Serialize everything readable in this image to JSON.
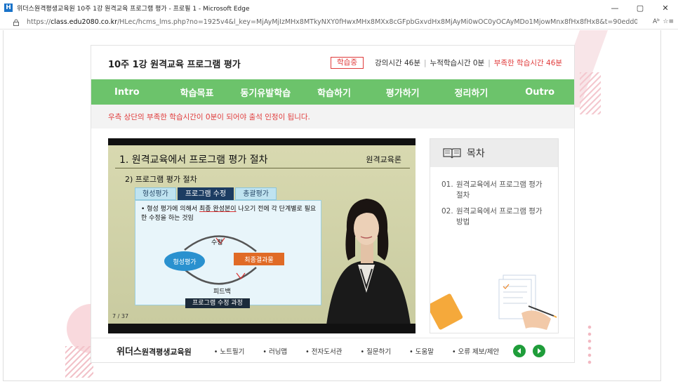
{
  "window": {
    "app_icon": "H",
    "title": "위더스원격평생교육원 10주 1강 원격교육 프로그램 평가 - 프로필 1 - Microsoft Edge",
    "min_icon": "—",
    "max_icon": "▢",
    "close_icon": "✕"
  },
  "address": {
    "url_prefix": "https://",
    "url_host": "class.edu2080.co.kr",
    "url_rest": "/HLec/hcms_lms.php?no=1925v4&l_key=MjAyMjIzMHx8MTkyNXY0fHwxMHx8MXx8cGFpbGxvdHx8MjAyMi0wOC0yOCAyMDo1MjowMnx8fHx8fHx8&t=90edd038f48d4ff53ca205...",
    "read_aloud": "Aᵇ",
    "extra": "☆≡"
  },
  "header": {
    "title": "10주 1강 원격교육 프로그램 평가",
    "status_badge": "학습중",
    "lecture_time": "강의시간 46분",
    "accumulated_time": "누적학습시간 0분",
    "remaining_time": "부족한 학습시간 46분"
  },
  "nav": {
    "items": [
      "Intro",
      "학습목표",
      "동기유발학습",
      "학습하기",
      "평가하기",
      "정리하기",
      "Outro"
    ]
  },
  "notice": "우측 상단의 부족한 학습시간이 0분이 되어야 출석 인정이 됩니다.",
  "slide": {
    "title": "1. 원격교육에서 프로그램 평가 절차",
    "tag": "원격교육론",
    "subtitle": "2) 프로그램 평가 절차",
    "tabs": [
      "형성평가",
      "프로그램 수정",
      "총괄평가"
    ],
    "bullet_pre": "• 형성 평가에 의해서 ",
    "bullet_underline": "최종 완성본이",
    "bullet_post": " 나오기 전에 각 단계별로 필요한 수정을 하는 것임",
    "node_formative": "형성평가",
    "node_final": "최종결과물",
    "label_revise": "수정",
    "label_feedback": "피드백",
    "caption": "프로그램 수정 과정",
    "page_number": "7 / 37"
  },
  "toc": {
    "heading": "목차",
    "items": [
      {
        "num": "01.",
        "text": "원격교육에서 프로그램 평가 절차"
      },
      {
        "num": "02.",
        "text": "원격교육에서 프로그램 평가 방법"
      }
    ]
  },
  "footer": {
    "logo_main": "위더스",
    "logo_sub": "원격평생교육원",
    "links": [
      "• 노트필기",
      "• 러닝맵",
      "• 전자도서관",
      "• 질문하기",
      "• 도움말",
      "• 오류 제보/제안"
    ]
  },
  "colors": {
    "nav_green": "#6cc36b",
    "alert_red": "#e03b3b",
    "arrow_green": "#1f9d3a"
  }
}
